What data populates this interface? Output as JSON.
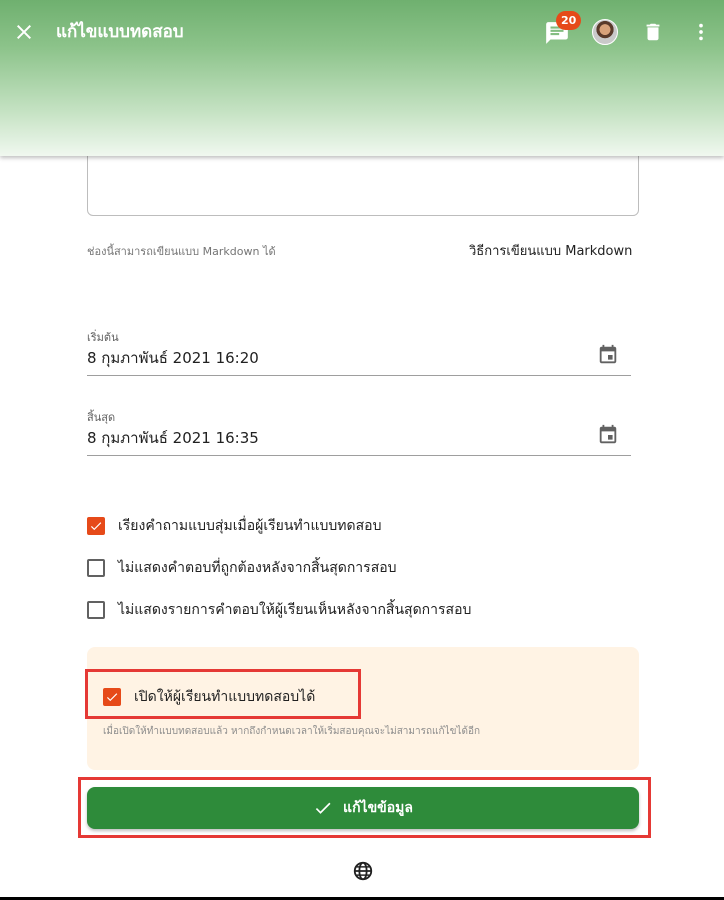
{
  "header": {
    "title": "แก้ไขแบบทดสอบ",
    "notification_count": "20",
    "icons": [
      "close-icon",
      "chat-icon",
      "avatar",
      "trash-icon",
      "more-vert-icon"
    ]
  },
  "description": {
    "markdown_hint": "ช่องนี้สามารถเขียนแบบ Markdown ได้",
    "markdown_link": "วิธีการเขียนแบบ Markdown"
  },
  "schedule": {
    "start_label": "เริ่มต้น",
    "start_value": "8 กุมภาพันธ์ 2021 16:20",
    "end_label": "สิ้นสุด",
    "end_value": "8 กุมภาพันธ์ 2021 16:35"
  },
  "options": [
    {
      "label": "เรียงคำถามแบบสุ่มเมื่อผู้เรียนทำแบบทดสอบ",
      "checked": true
    },
    {
      "label": "ไม่แสดงคำตอบที่ถูกต้องหลังจากสิ้นสุดการสอบ",
      "checked": false
    },
    {
      "label": "ไม่แสดงรายการคำตอบให้ผู้เรียนเห็นหลังจากสิ้นสุดการสอบ",
      "checked": false
    }
  ],
  "publish": {
    "label": "เปิดให้ผู้เรียนทำแบบทดสอบได้",
    "checked": true,
    "hint": "เมื่อเปิดให้ทำแบบทดสอบแล้ว หากถึงกำหนดเวลาให้เริ่มสอบคุณจะไม่สามารถแก้ไขได้อีก"
  },
  "submit": {
    "label": "แก้ไขข้อมูล"
  },
  "colors": {
    "header": "#6fb06f",
    "accent": "#e64a19",
    "submit": "#2e8b3a",
    "notice_bg": "#fff3e4",
    "highlight": "#e53935"
  }
}
